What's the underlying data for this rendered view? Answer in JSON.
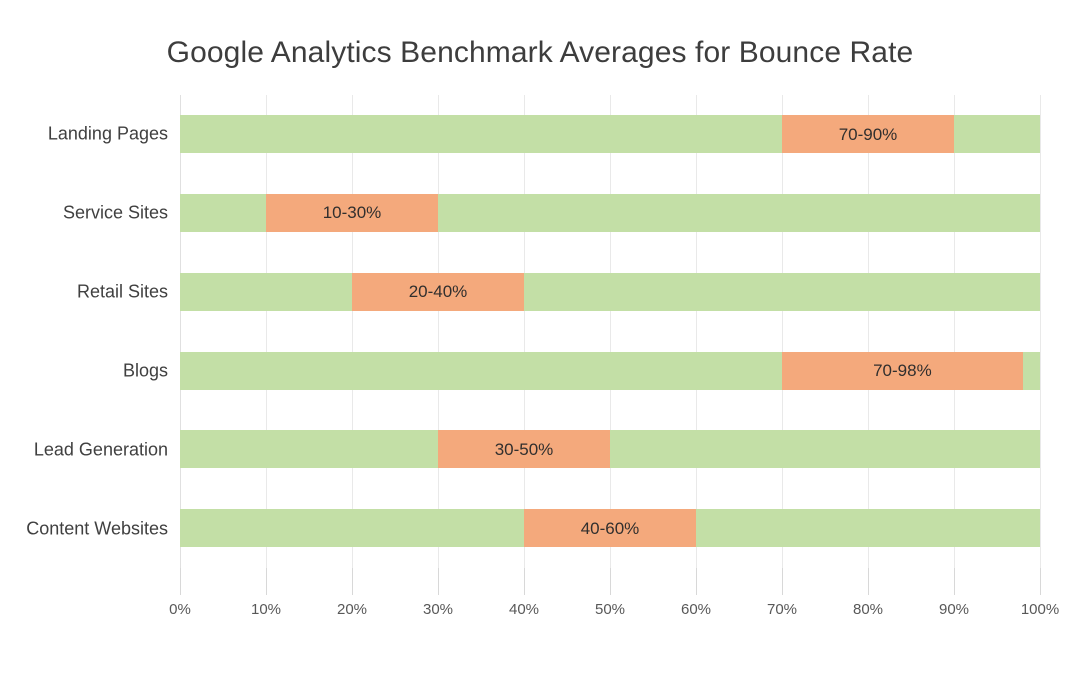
{
  "chart_data": {
    "type": "bar",
    "title": "Google Analytics Benchmark Averages for Bounce Rate",
    "subtitle": "",
    "xlabel": "",
    "ylabel": "",
    "orientation": "horizontal",
    "xlim": [
      0,
      100
    ],
    "grid": true,
    "legend": "none",
    "axis_tick_suffix": "%",
    "xticks": [
      0,
      10,
      20,
      30,
      40,
      50,
      60,
      70,
      80,
      90,
      100
    ],
    "xtick_labels": [
      "0%",
      "10%",
      "20%",
      "30%",
      "40%",
      "50%",
      "60%",
      "70%",
      "80%",
      "90%",
      "100%"
    ],
    "categories": [
      "Landing Pages",
      "Service Sites",
      "Retail Sites",
      "Blogs",
      "Lead Generation",
      "Content Websites"
    ],
    "colors": {
      "track": "#c3dfa6",
      "range": "#f4a97c",
      "title_text": "#3d3d3d",
      "axis_text": "#585858",
      "category_text": "#404040",
      "gridline": "#e9e9e9",
      "value_text": "#312f2e",
      "background": "#ffffff"
    },
    "bars": [
      {
        "category": "Landing Pages",
        "track_start": 0,
        "track_end": 100,
        "range_start": 70,
        "range_end": 90,
        "label": "70-90%"
      },
      {
        "category": "Service Sites",
        "track_start": 0,
        "track_end": 100,
        "range_start": 10,
        "range_end": 30,
        "label": "10-30%"
      },
      {
        "category": "Retail Sites",
        "track_start": 0,
        "track_end": 100,
        "range_start": 20,
        "range_end": 40,
        "label": "20-40%"
      },
      {
        "category": "Blogs",
        "track_start": 0,
        "track_end": 100,
        "range_start": 70,
        "range_end": 98,
        "label": "70-98%"
      },
      {
        "category": "Lead Generation",
        "track_start": 0,
        "track_end": 100,
        "range_start": 30,
        "range_end": 50,
        "label": "30-50%"
      },
      {
        "category": "Content Websites",
        "track_start": 0,
        "track_end": 100,
        "range_start": 40,
        "range_end": 60,
        "label": "40-60%"
      }
    ]
  }
}
